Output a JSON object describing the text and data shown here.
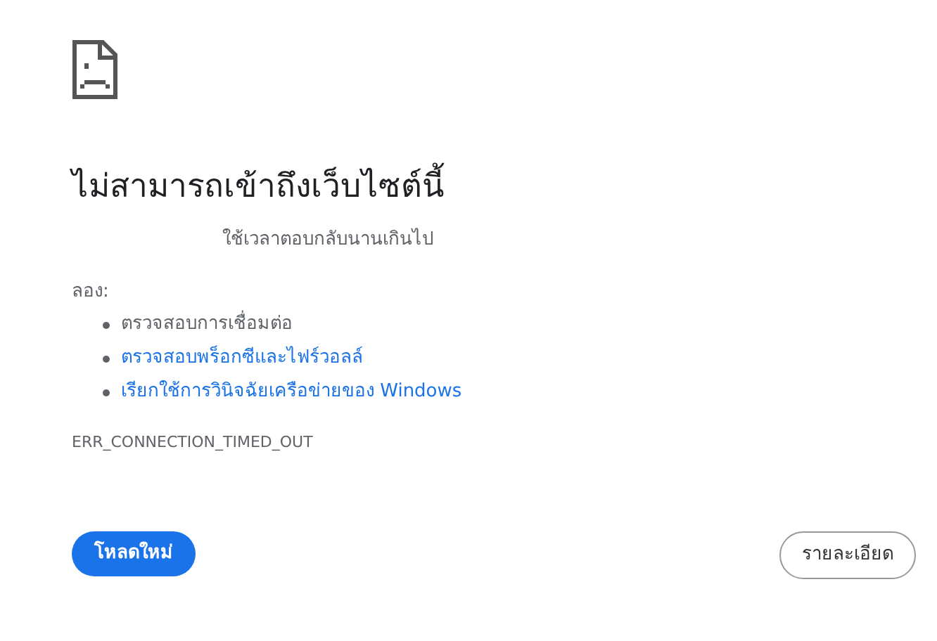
{
  "title": "ไม่สามารถเข้าถึงเว็บไซต์นี้",
  "description": "ใช้เวลาตอบกลับนานเกินไป",
  "suggestions_heading": "ลอง:",
  "suggestions": [
    {
      "kind": "text",
      "label": "ตรวจสอบการเชื่อมต่อ"
    },
    {
      "kind": "link",
      "label": "ตรวจสอบพร็อกซีและไฟร์วอลล์"
    },
    {
      "kind": "link",
      "label": "เรียกใช้การวินิจฉัยเครือข่ายของ Windows"
    }
  ],
  "error_code": "ERR_CONNECTION_TIMED_OUT",
  "buttons": {
    "reload": "โหลดใหม่",
    "details": "รายละเอียด"
  }
}
